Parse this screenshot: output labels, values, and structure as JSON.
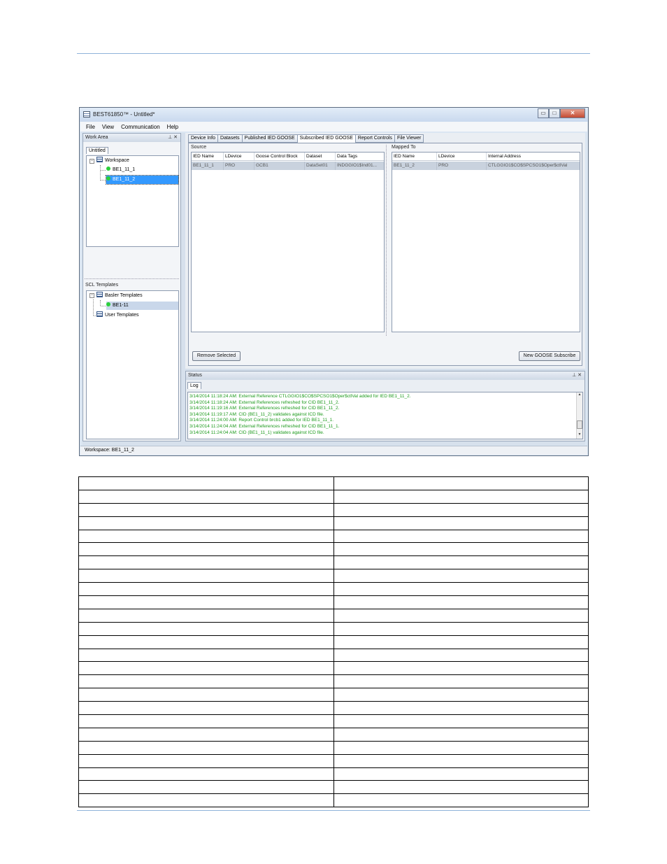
{
  "window": {
    "title": "BEST61850™ - Untitled*",
    "min_glyph": "▭",
    "max_glyph": "□",
    "close_glyph": "✕"
  },
  "menu": {
    "items": [
      {
        "id": "file",
        "label": "File"
      },
      {
        "id": "view",
        "label": "View"
      },
      {
        "id": "communication",
        "label": "Communication"
      },
      {
        "id": "help",
        "label": "Help"
      }
    ]
  },
  "work_area": {
    "header": "Work Area",
    "pin": "⊥ ✕",
    "tab": "Untitled",
    "workspace_label": "Workspace",
    "items": [
      "BE1_11_1",
      "BE1_11_2"
    ],
    "selected": "BE1_11_2"
  },
  "scl_templates": {
    "header": "SCL Templates",
    "basler_label": "Basler Templates",
    "basler_item": "BE1-11",
    "user_label": "User Templates"
  },
  "tabs": [
    {
      "label": "Device Info",
      "active": false
    },
    {
      "label": "Datasets",
      "active": false
    },
    {
      "label": "Published IED GOOSE",
      "active": false
    },
    {
      "label": "Subscribed IED GOOSE",
      "active": true
    },
    {
      "label": "Report Controls",
      "active": false
    },
    {
      "label": "File Viewer",
      "active": false
    }
  ],
  "source": {
    "label": "Source",
    "columns": [
      "IED Name",
      "LDevice",
      "Goose Control Block",
      "Dataset",
      "Data Tags"
    ],
    "rows": [
      [
        "BE1_11_1",
        "PRO",
        "GCB1",
        "DataSet01",
        "INDGGIO1$Ind01..."
      ]
    ]
  },
  "mapped": {
    "label": "Mapped To",
    "columns": [
      "IED Name",
      "LDevice",
      "Internal Address"
    ],
    "rows": [
      [
        "BE1_11_2",
        "PRO",
        "CTLGGIO1$CO$SPCSO1$Oper$ctlVal"
      ]
    ]
  },
  "buttons": {
    "remove": "Remove Selected",
    "new_goose": "New GOOSE Subscribe"
  },
  "status": {
    "header": "Status",
    "pin": "⊥ ✕",
    "tab": "Log",
    "log": [
      "3/14/2014 11:18:24 AM: External Reference CTLGGIO1$CO$SPCSO1$Oper$ctlVal added for IED BE1_11_2.",
      "3/14/2014 11:18:24 AM: External References refreshed for CID BE1_11_2.",
      "3/14/2014 11:19:16 AM: External References refreshed for CID BE1_11_2.",
      "3/14/2014 11:19:17 AM: CID (BE1_11_2) validates against ICD file.",
      "3/14/2014 11:24:00 AM: Report Control brcb1 added for IED BE1_11_1.",
      "3/14/2014 11:24:04 AM: External References refreshed for CID BE1_11_1.",
      "3/14/2014 11:24:04 AM: CID (BE1_11_1) validates against ICD file."
    ]
  },
  "status_bar": "Workspace: BE1_11_2",
  "empty_table": {
    "rows": 25,
    "cols": 2
  }
}
